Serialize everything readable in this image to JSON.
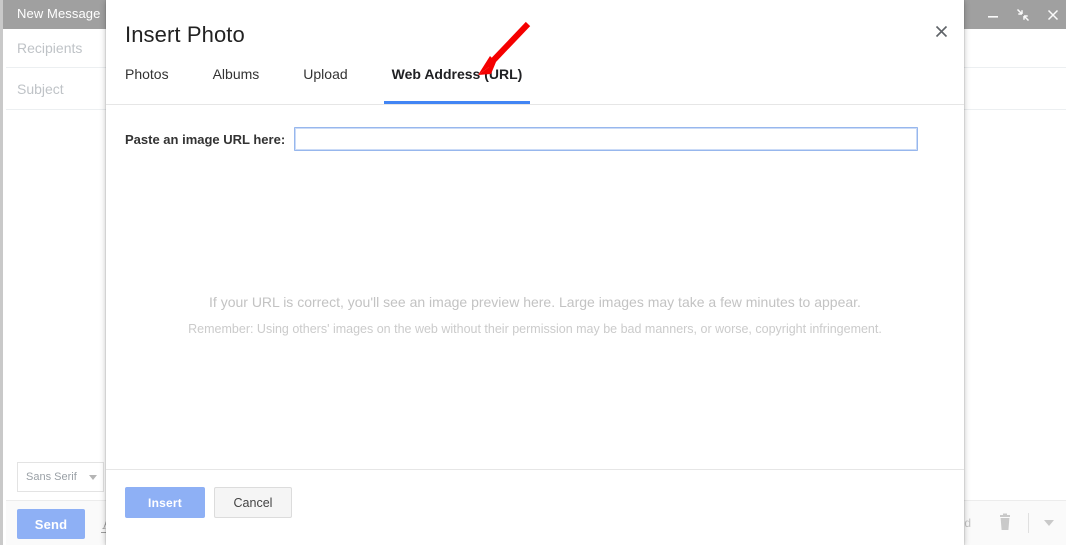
{
  "compose_window": {
    "title": "New Message",
    "fields": [
      {
        "name": "recipients",
        "placeholder": "Recipients"
      },
      {
        "name": "subject",
        "placeholder": "Subject"
      }
    ],
    "font_picker": {
      "value": "Sans Serif"
    },
    "footer": {
      "send_label": "Send",
      "format_label": "A",
      "saved_text": "ved",
      "trash_icon": "trash-icon",
      "caret_icon": "chevron-down-icon"
    },
    "window_controls": {
      "minimize": "minimize-icon",
      "restore": "restore-down-icon",
      "close": "close-icon"
    }
  },
  "dialog": {
    "title": "Insert Photo",
    "close_icon": "close-icon",
    "tabs": [
      {
        "label": "Photos",
        "active": false
      },
      {
        "label": "Albums",
        "active": false
      },
      {
        "label": "Upload",
        "active": false
      },
      {
        "label": "Web Address (URL)",
        "active": true
      }
    ],
    "url_field": {
      "label": "Paste an image URL here:",
      "value": "",
      "placeholder": ""
    },
    "preview": {
      "line1": "If your URL is correct, you'll see an image preview here. Large images may take a few minutes to appear.",
      "line2": "Remember: Using others' images on the web without their permission may be bad manners, or worse, copyright infringement."
    },
    "footer": {
      "insert_label": "Insert",
      "cancel_label": "Cancel"
    }
  },
  "annotation": {
    "arrow_color": "#f50000",
    "points_to": "Web Address (URL)"
  },
  "colors": {
    "accent_blue": "#4285f4",
    "button_blue": "#8eb0f5",
    "header_gray": "#a0a0a0",
    "annotation_red": "#f50000"
  }
}
